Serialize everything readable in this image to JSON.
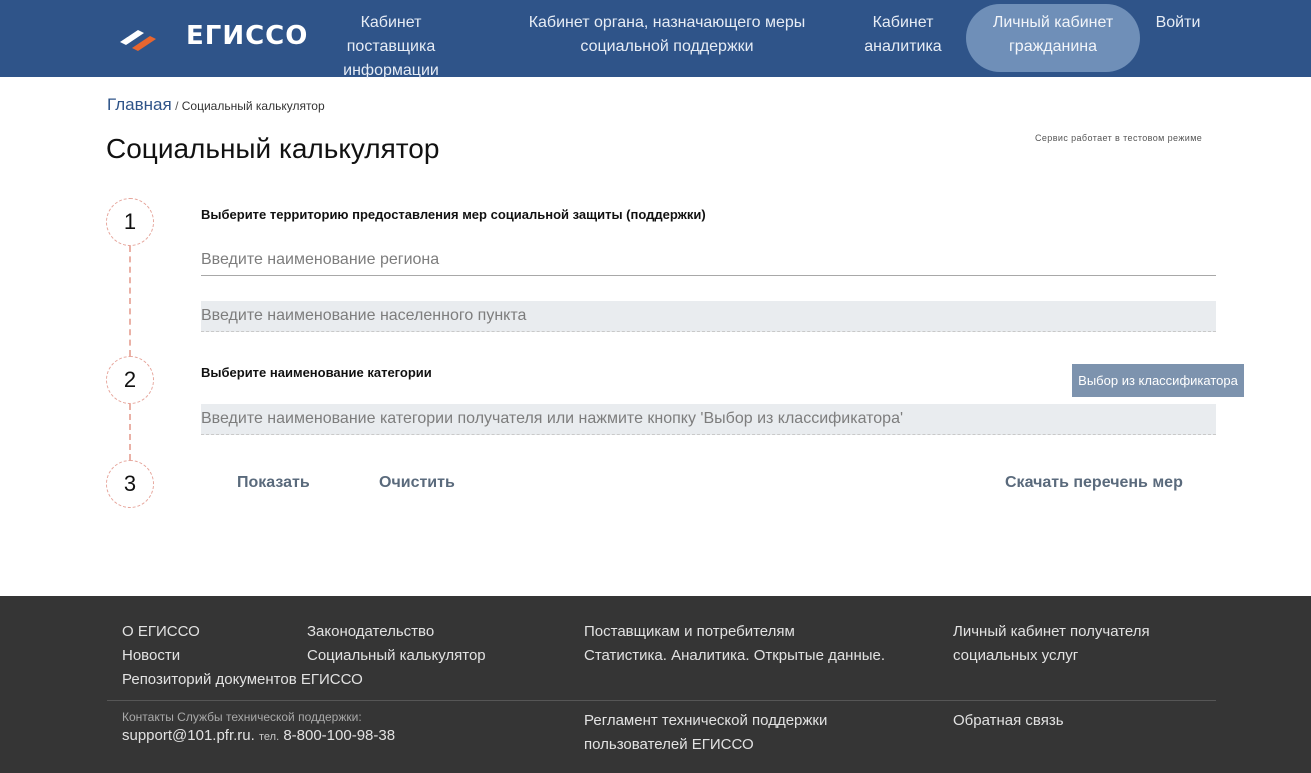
{
  "header": {
    "logo_text": "ЕГИССО",
    "nav": [
      {
        "line1": "Кабинет поставщика",
        "line2": "информации"
      },
      {
        "line1": "Кабинет органа, назначающего меры",
        "line2": "социальной поддержки"
      },
      {
        "line1": "Кабинет",
        "line2": "аналитика"
      },
      {
        "line1": "Личный кабинет",
        "line2": "гражданина"
      }
    ],
    "login": "Войти",
    "colors": {
      "bar": "#2f5489",
      "active_pill": "#6f8fb8"
    }
  },
  "breadcrumb": {
    "home": "Главная",
    "separator": "/",
    "current": "Социальный калькулятор"
  },
  "page_title": "Социальный калькулятор",
  "test_mode": "Сервис работает в тестовом режиме",
  "steps": {
    "s1": {
      "number": "1",
      "label": "Выберите территорию предоставления мер социальной защиты (поддержки)",
      "region_placeholder": "Введите наименование региона",
      "settlement_placeholder": "Введите наименование населенного пункта"
    },
    "s2": {
      "number": "2",
      "label": "Выберите наименование категории",
      "classifier_button": "Выбор из классификатора",
      "category_placeholder": "Введите наименование категории получателя или нажмите кнопку 'Выбор из классификатора'"
    },
    "s3": {
      "number": "3",
      "show": "Показать",
      "clear": "Очистить",
      "download": "Скачать перечень мер"
    }
  },
  "footer": {
    "about": "О ЕГИССО",
    "news": "Новости",
    "repository": "Репозиторий документов ЕГИССО",
    "legislation": "Законодательство",
    "calculator": "Социальный калькулятор",
    "providers": "Поставщикам и потребителям",
    "stats": "Статистика. Аналитика. Открытые данные.",
    "cabinet_line1": "Личный кабинет получателя",
    "cabinet_line2": "социальных услуг",
    "contacts_label": "Контакты Службы технической поддержки:",
    "email": "support@101.pfr.ru.",
    "tel_label": "тел.",
    "phone": "8-800-100-98-38",
    "reglament_line1": "Регламент технической поддержки",
    "reglament_line2": "пользователей ЕГИССО",
    "feedback": "Обратная связь"
  }
}
